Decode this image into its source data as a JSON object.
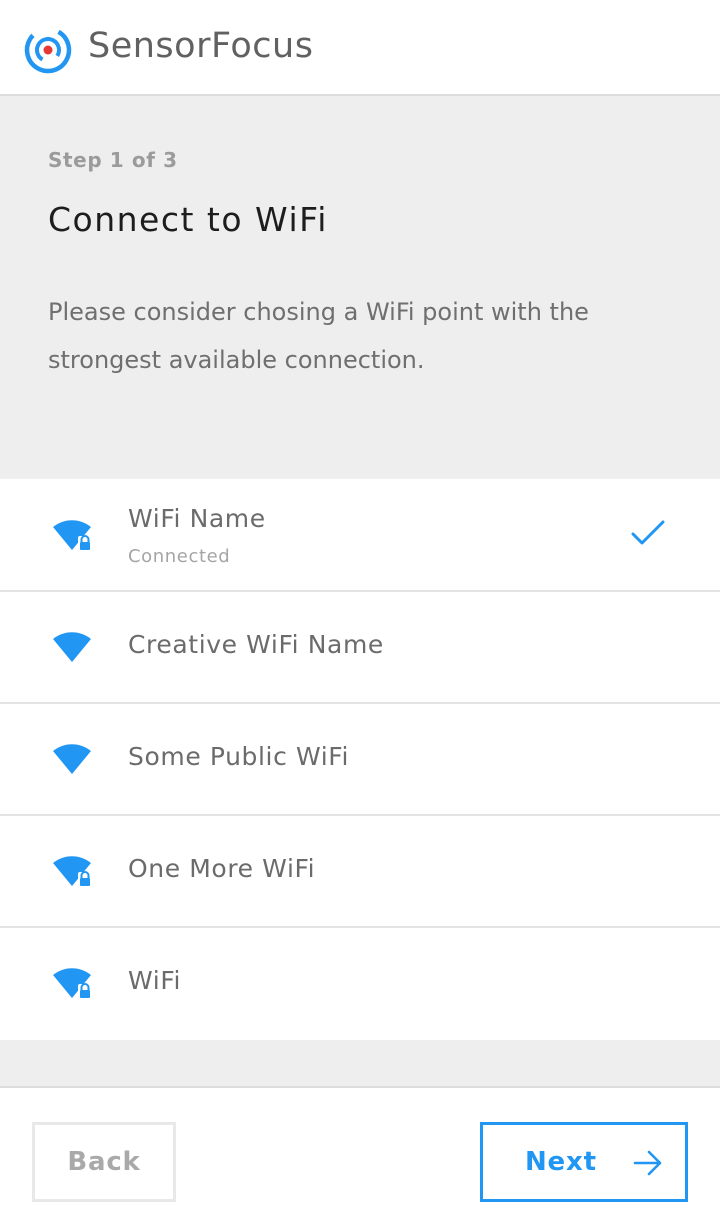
{
  "header": {
    "brand": "SensorFocus"
  },
  "intro": {
    "step": "Step 1 of 3",
    "title": "Connect to WiFi",
    "description": "Please consider chosing a WiFi point with the strongest available connection."
  },
  "networks": [
    {
      "name": "WiFi Name",
      "status": "Connected",
      "locked": true,
      "selected": true
    },
    {
      "name": "Creative WiFi Name",
      "status": "",
      "locked": false,
      "selected": false
    },
    {
      "name": "Some Public WiFi",
      "status": "",
      "locked": false,
      "selected": false
    },
    {
      "name": "One More WiFi",
      "status": "",
      "locked": true,
      "selected": false
    },
    {
      "name": "WiFi",
      "status": "",
      "locked": true,
      "selected": false
    }
  ],
  "footer": {
    "back_label": "Back",
    "next_label": "Next"
  },
  "colors": {
    "accent": "#2196f3",
    "logo_dot": "#e53935",
    "panel_bg": "#eeeeee",
    "divider": "#e3e3e3"
  },
  "icons": {
    "logo": "sensorfocus-logo-icon",
    "wifi": "wifi-icon",
    "lock": "lock-icon",
    "check": "checkmark-icon",
    "next": "arrow-right-icon"
  }
}
